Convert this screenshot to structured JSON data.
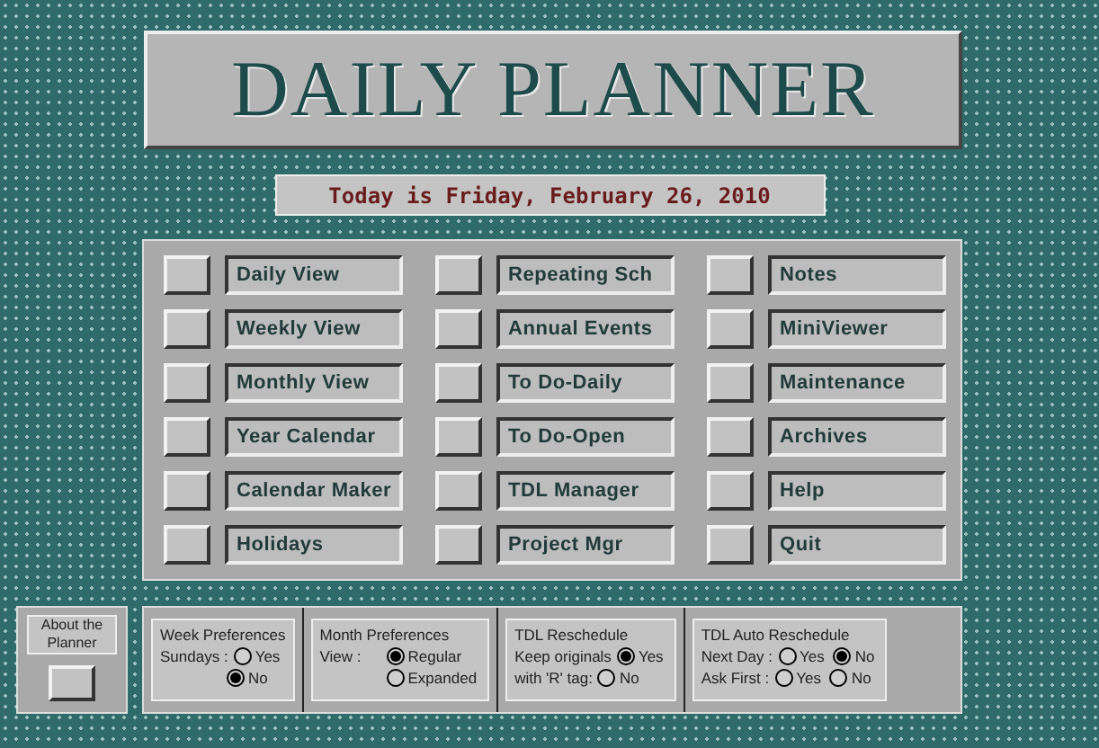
{
  "title": "DAILY PLANNER",
  "date_banner": "Today is Friday, February 26, 2010",
  "menu_columns": [
    {
      "items": [
        "Daily View",
        "Weekly View",
        "Monthly View",
        "Year Calendar",
        "Calendar Maker",
        "Holidays"
      ]
    },
    {
      "items": [
        "Repeating Sch",
        "Annual Events",
        "To Do-Daily",
        "To Do-Open",
        "TDL Manager",
        "Project Mgr"
      ]
    },
    {
      "items": [
        "Notes",
        "MiniViewer",
        "Maintenance",
        "Archives",
        "Help",
        "Quit"
      ]
    }
  ],
  "about": {
    "label": "About the Planner"
  },
  "preferences": [
    {
      "title": "Week Preferences",
      "lines": [
        {
          "label": "Sundays :",
          "options": [
            {
              "label": "Yes",
              "selected": false
            }
          ]
        },
        {
          "options": [
            {
              "label": "No",
              "selected": true
            }
          ]
        }
      ]
    },
    {
      "title": "Month Preferences",
      "lines": [
        {
          "label": "View :",
          "options": [
            {
              "label": "Regular",
              "selected": true
            }
          ]
        },
        {
          "options": [
            {
              "label": "Expanded",
              "selected": false
            }
          ]
        }
      ]
    },
    {
      "title": "TDL Reschedule",
      "lines": [
        {
          "label": "Keep originals",
          "options": [
            {
              "label": "Yes",
              "selected": true
            }
          ]
        },
        {
          "label": "with 'R' tag:",
          "options": [
            {
              "label": "No",
              "selected": false
            }
          ]
        }
      ]
    },
    {
      "title": "TDL Auto Reschedule",
      "lines": [
        {
          "label": "Next Day :",
          "options": [
            {
              "label": "Yes",
              "selected": false
            },
            {
              "label": "No",
              "selected": true
            }
          ]
        },
        {
          "label": "Ask First :",
          "options": [
            {
              "label": "Yes",
              "selected": false
            },
            {
              "label": "No",
              "selected": false
            }
          ]
        }
      ]
    }
  ]
}
